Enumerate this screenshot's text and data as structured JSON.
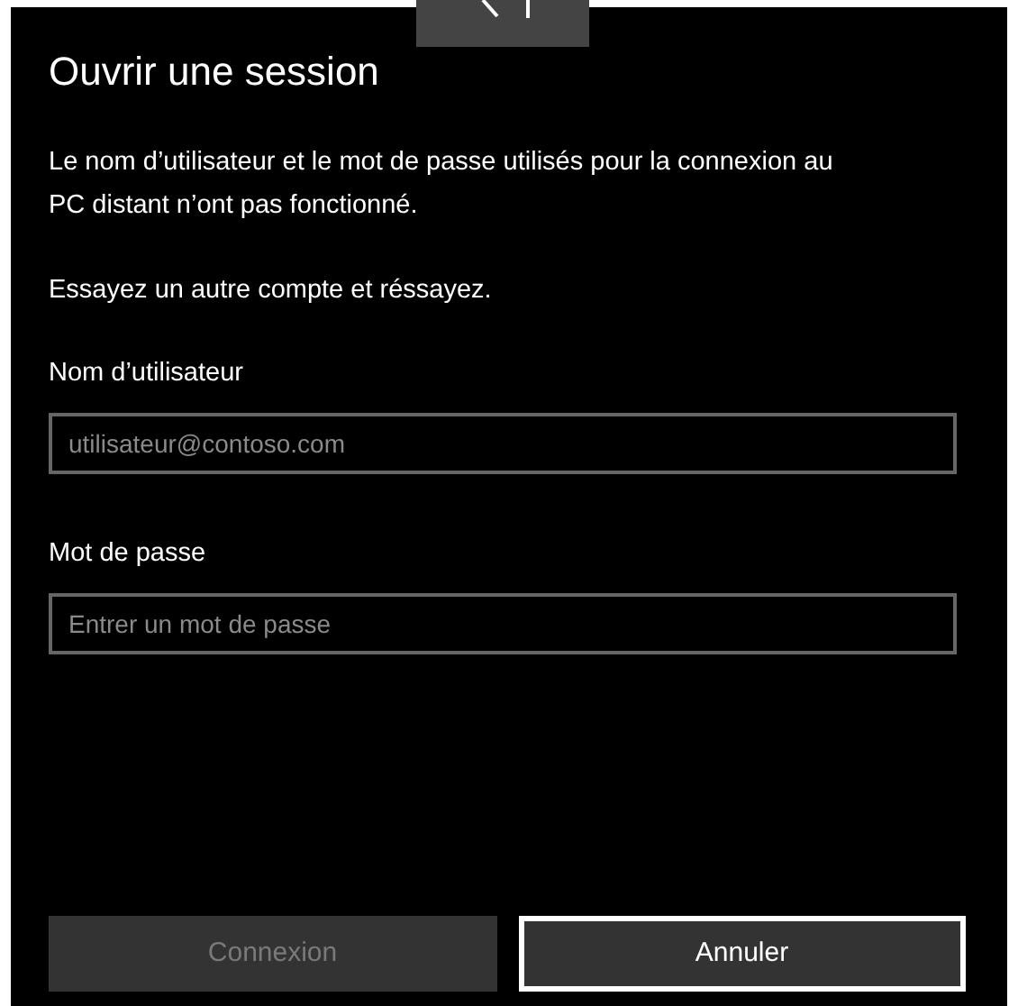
{
  "title": "Ouvrir une session",
  "message": [
    "Le nom d’utilisateur et le mot de passe utilisés pour la connexion au PC distant n’ont pas fonctionné.",
    "Essayez un autre compte et réssayez."
  ],
  "fields": [
    {
      "label": "Nom d’utilisateur",
      "placeholder": "utilisateur@contoso.com"
    },
    {
      "label": "Mot de passe",
      "placeholder": "Entrer un mot de passe"
    }
  ],
  "buttons": [
    {
      "label": "Connexion",
      "disabled": true,
      "focused": false
    },
    {
      "label": "Annuler",
      "disabled": false,
      "focused": true
    }
  ]
}
